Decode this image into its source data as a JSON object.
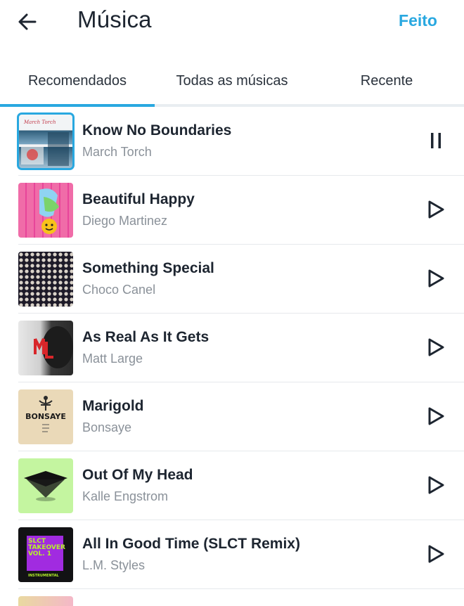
{
  "header": {
    "title": "Música",
    "done_label": "Feito",
    "accent_color": "#29a8e0"
  },
  "tabs": [
    {
      "label": "Recomendados",
      "active": true
    },
    {
      "label": "Todas as músicas",
      "active": false
    },
    {
      "label": "Recente",
      "active": false
    }
  ],
  "songs": [
    {
      "title": "Know No Boundaries",
      "artist": "March Torch",
      "state": "playing",
      "icon": "pause-icon"
    },
    {
      "title": "Beautiful Happy",
      "artist": "Diego Martinez",
      "state": "stopped",
      "icon": "play-icon"
    },
    {
      "title": "Something Special",
      "artist": "Choco Canel",
      "state": "stopped",
      "icon": "play-icon"
    },
    {
      "title": "As Real As It Gets",
      "artist": "Matt Large",
      "state": "stopped",
      "icon": "play-icon"
    },
    {
      "title": "Marigold",
      "artist": "Bonsaye",
      "state": "stopped",
      "icon": "play-icon"
    },
    {
      "title": "Out Of My Head",
      "artist": "Kalle Engstrom",
      "state": "stopped",
      "icon": "play-icon"
    },
    {
      "title": "All In Good Time (SLCT Remix)",
      "artist": "L.M. Styles",
      "state": "stopped",
      "icon": "play-icon"
    }
  ],
  "album_art_text": {
    "marigold": "BONSAYE",
    "slct": [
      "SLCT",
      "TAKEOVER",
      "VOL. 1",
      "INSTRUMENTAL"
    ]
  }
}
